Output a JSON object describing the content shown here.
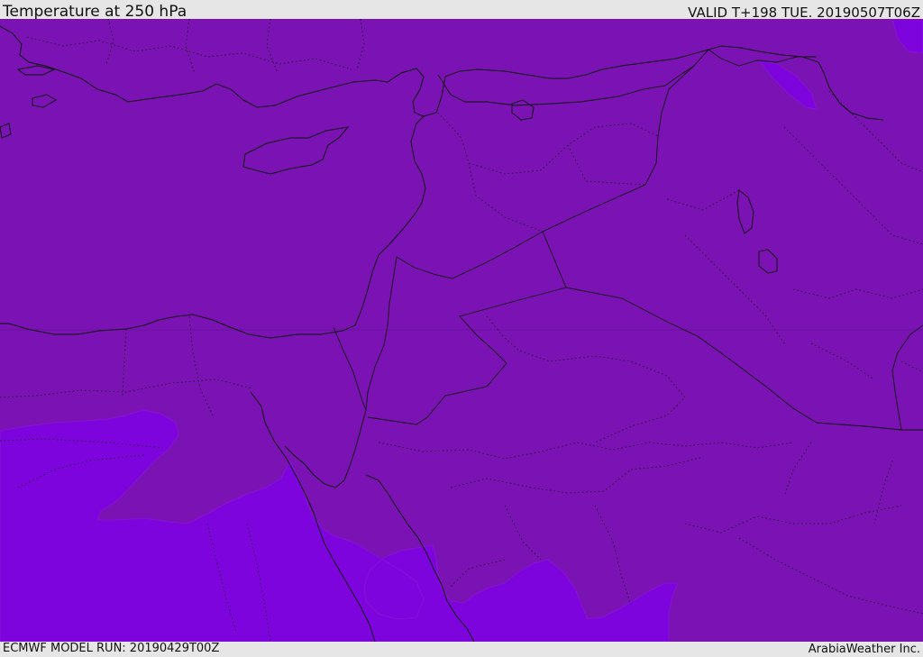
{
  "header": {
    "title": "Temperature at 250 hPa",
    "valid_time": "VALID T+198 TUE. 20190507T06Z"
  },
  "footer": {
    "model_run": "ECMWF MODEL RUN: 20190429T00Z",
    "credit": "ArabiaWeather Inc."
  },
  "map": {
    "colors": {
      "field_main": "#7a12b4",
      "field_cold": "#7d04dc",
      "field_cold_edge": "#8a10d8",
      "coastline": "#111111",
      "border": "#111111"
    }
  }
}
